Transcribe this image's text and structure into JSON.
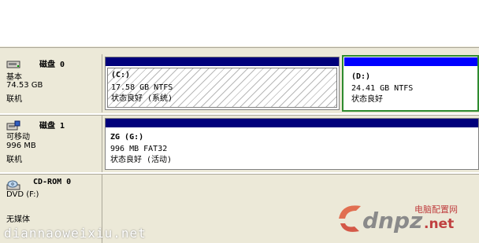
{
  "disks": [
    {
      "name": "磁盘 0",
      "type": "基本",
      "size": "74.53 GB",
      "status": "联机",
      "icon": "hard-disk-icon",
      "volumes": [
        {
          "name": "(C:)",
          "size_fs": "17.58 GB NTFS",
          "health": "状态良好 (系统)",
          "bar_color": "#00007b"
        },
        {
          "name": "(D:)",
          "size_fs": "24.41 GB NTFS",
          "health": "状态良好",
          "bar_color": "#0000ff"
        }
      ]
    },
    {
      "name": "磁盘 1",
      "type": "可移动",
      "size": "996 MB",
      "status": "联机",
      "icon": "removable-disk-icon",
      "volumes": [
        {
          "name": "ZG  (G:)",
          "size_fs": "996 MB FAT32",
          "health": "状态良好 (活动)",
          "bar_color": "#00007b"
        }
      ]
    },
    {
      "name": "CD-ROM 0",
      "type": "DVD (F:)",
      "status": "无媒体",
      "icon": "cdrom-icon"
    }
  ],
  "watermark": {
    "site": "diannaoweixiu.net",
    "logo_main": "dnpz",
    "logo_cn": "电脑配置网",
    "logo_suffix": ".net"
  },
  "colors": {
    "primary_bar": "#00007b",
    "logical_bar": "#0000ff",
    "selected_border": "#2e8b2e",
    "panel_bg": "#ece9d8"
  }
}
